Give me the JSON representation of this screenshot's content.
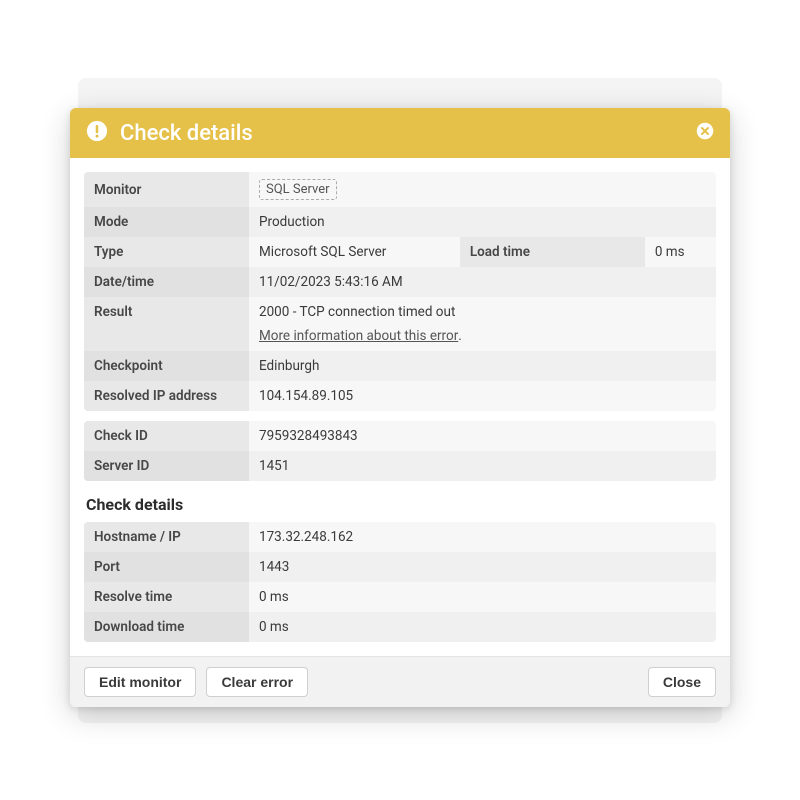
{
  "modal": {
    "title": "Check details",
    "sections": {
      "main": {
        "monitor_label": "Monitor",
        "monitor_value": "SQL Server",
        "mode_label": "Mode",
        "mode_value": "Production",
        "type_label": "Type",
        "type_value": "Microsoft SQL Server",
        "load_time_label": "Load time",
        "load_time_value": "0 ms",
        "datetime_label": "Date/time",
        "datetime_value": "11/02/2023 5:43:16 AM",
        "result_label": "Result",
        "result_value": "2000 - TCP connection timed out",
        "result_link": "More information about this error",
        "result_link_suffix": ".",
        "checkpoint_label": "Checkpoint",
        "checkpoint_value": "Edinburgh",
        "resolved_ip_label": "Resolved IP address",
        "resolved_ip_value": "104.154.89.105"
      },
      "ids": {
        "check_id_label": "Check ID",
        "check_id_value": "7959328493843",
        "server_id_label": "Server ID",
        "server_id_value": "1451"
      },
      "details_title": "Check details",
      "details": {
        "hostname_label": "Hostname / IP",
        "hostname_value": "173.32.248.162",
        "port_label": "Port",
        "port_value": "1443",
        "resolve_time_label": "Resolve time",
        "resolve_time_value": "0 ms",
        "download_time_label": "Download time",
        "download_time_value": "0 ms"
      }
    },
    "footer": {
      "edit_label": "Edit monitor",
      "clear_label": "Clear error",
      "close_label": "Close"
    }
  }
}
